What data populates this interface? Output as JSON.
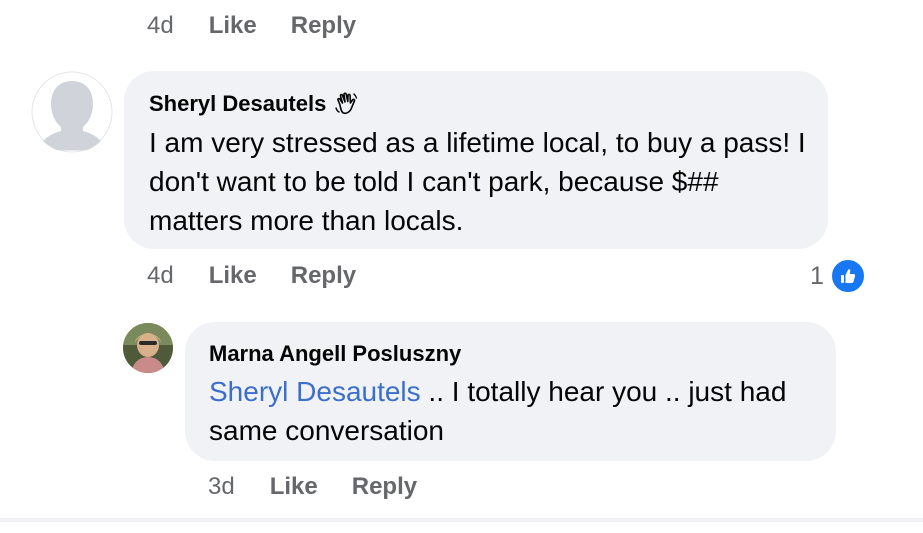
{
  "top_comment_actions": {
    "time": "4d",
    "like_label": "Like",
    "reply_label": "Reply"
  },
  "comment": {
    "author": "Sheryl Desautels",
    "author_badge_icon": "wave-hand-icon",
    "text": "I am very stressed as a lifetime local, to buy a pass! I don't want to be told I can't park, because $##  matters more than locals.",
    "actions": {
      "time": "4d",
      "like_label": "Like",
      "reply_label": "Reply"
    },
    "reaction_count": "1",
    "reaction_icon": "thumbs-up-icon"
  },
  "reply": {
    "author": "Marna Angell Posluszny",
    "mention": "Sheryl Desautels",
    "text": " .. I totally hear you .. just had same conversation",
    "actions": {
      "time": "3d",
      "like_label": "Like",
      "reply_label": "Reply"
    }
  },
  "colors": {
    "bubble_bg": "#f0f2f5",
    "meta_text": "#65676b",
    "mention": "#3b6fc9",
    "like_blue": "#1877f2"
  }
}
